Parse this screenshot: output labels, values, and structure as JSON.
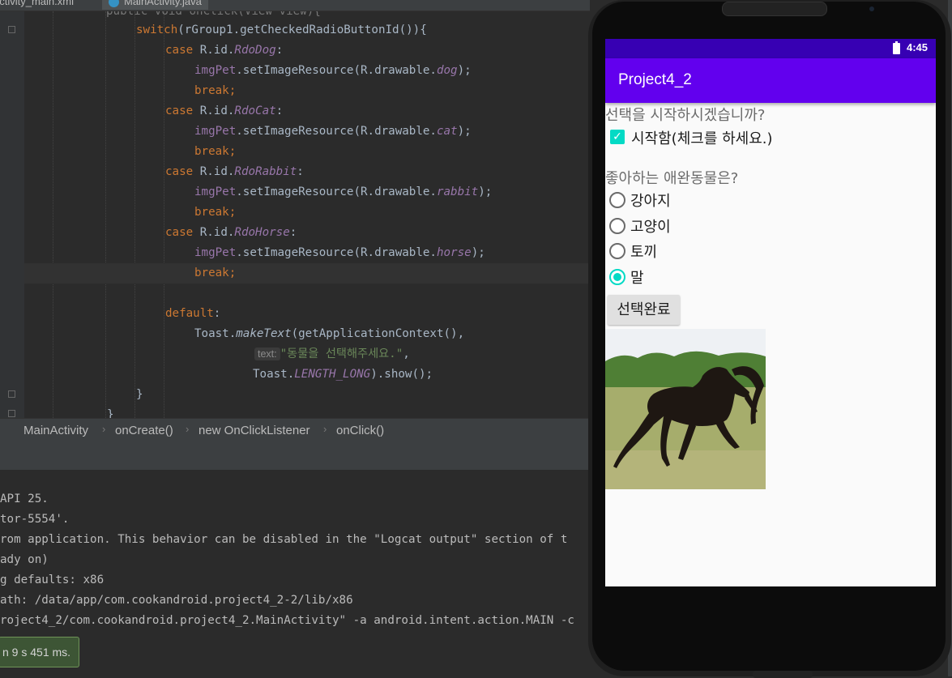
{
  "ide": {
    "tabs": [
      {
        "label": "activity_main.xml"
      },
      {
        "label": "MainActivity.java"
      }
    ],
    "code": {
      "line0": "public void onClick(View view){",
      "switch_kw": "switch",
      "switch_rest": "(rGroup1.getCheckedRadioButtonId()){",
      "case_kw": "case",
      "rid": " R.id.",
      "colon": ":",
      "imgpet": "imgPet",
      "setres": ".setImageResource(R.drawable.",
      "close": ");",
      "break_kw": "break;",
      "cases": [
        {
          "id": "RdoDog",
          "drawable": "dog"
        },
        {
          "id": "RdoCat",
          "drawable": "cat"
        },
        {
          "id": "RdoRabbit",
          "drawable": "rabbit"
        },
        {
          "id": "RdoHorse",
          "drawable": "horse"
        }
      ],
      "default_kw": "default",
      "toast": "Toast.",
      "maketext": "makeText",
      "toast_args": "(getApplicationContext(),",
      "hint": "text:",
      "toast_string": "\"동물을 선택해주세요.\"",
      "comma": ",",
      "toast_len_prefix": "Toast.",
      "toast_len": "LENGTH_LONG",
      "toast_show": ").show();",
      "brace": "}"
    },
    "breadcrumb": [
      "MainActivity",
      "onCreate()",
      "new OnClickListener",
      "onClick()"
    ],
    "console": [
      "API 25.",
      "tor-5554'.",
      "rom application. This behavior can be disabled in the \"Logcat output\" section of t",
      "ady on)",
      "g defaults: x86",
      "ath: /data/app/com.cookandroid.project4_2-2/lib/x86",
      "roject4_2/com.cookandroid.project4_2.MainActivity\" -a android.intent.action.MAIN -c"
    ],
    "notification": "n 9 s 451 ms."
  },
  "phone": {
    "status": {
      "time": "4:45",
      "battery_icon": "battery-charging-icon"
    },
    "app_title": "Project4_2",
    "question1": "선택을 시작하시겠습니까?",
    "start_checkbox": {
      "label": "시작함(체크를 하세요.)",
      "checked": true
    },
    "question2": "좋아하는 애완동물은?",
    "options": [
      {
        "label": "강아지",
        "selected": false
      },
      {
        "label": "고양이",
        "selected": false
      },
      {
        "label": "토끼",
        "selected": false
      },
      {
        "label": "말",
        "selected": true
      }
    ],
    "done_button": "선택완료",
    "image": "horse-photo",
    "colors": {
      "status_bar": "#3700b3",
      "app_bar": "#6200ee",
      "accent": "#03dac5"
    }
  }
}
